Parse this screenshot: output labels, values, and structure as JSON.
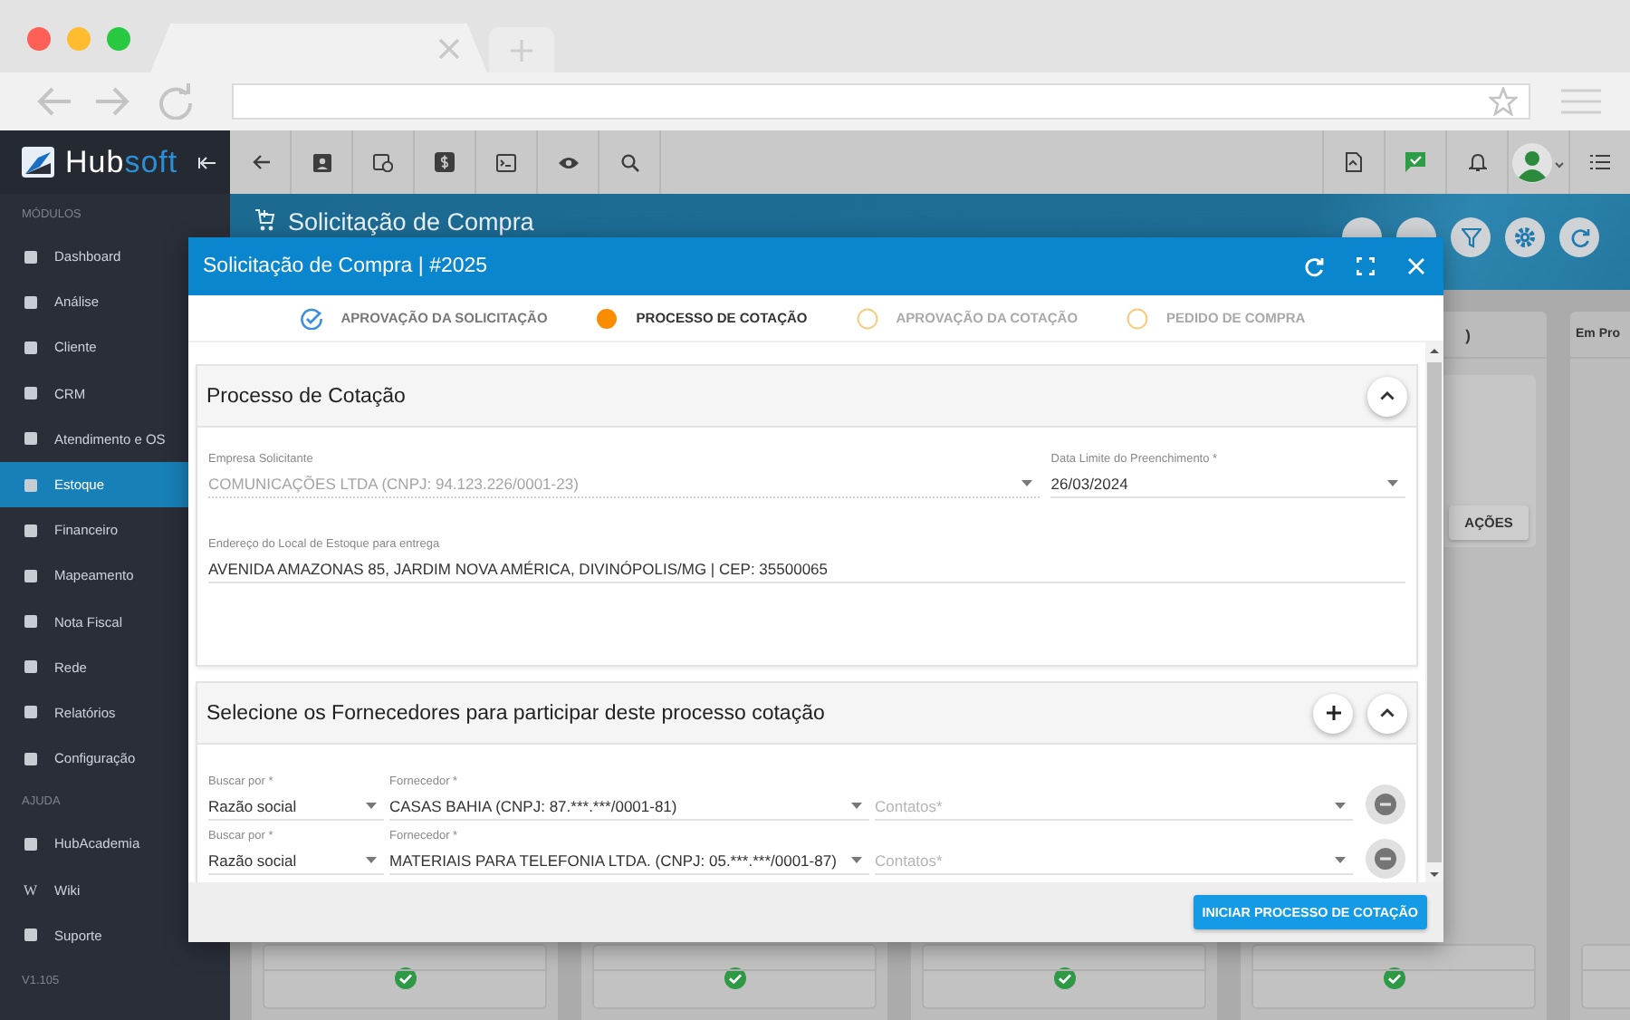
{
  "sidebar": {
    "logo": {
      "main": "Hub",
      "accent": "soft"
    },
    "sections": [
      {
        "title": "MÓDULOS",
        "items": [
          {
            "label": "Dashboard",
            "selected": false
          },
          {
            "label": "Análise",
            "selected": false
          },
          {
            "label": "Cliente",
            "selected": false
          },
          {
            "label": "CRM",
            "selected": false
          },
          {
            "label": "Atendimento e OS",
            "selected": false
          },
          {
            "label": "Estoque",
            "selected": true
          },
          {
            "label": "Financeiro",
            "selected": false
          },
          {
            "label": "Mapeamento",
            "selected": false
          },
          {
            "label": "Nota Fiscal",
            "selected": false
          },
          {
            "label": "Rede",
            "selected": false
          },
          {
            "label": "Relatórios",
            "selected": false
          },
          {
            "label": "Configuração",
            "selected": false
          }
        ]
      },
      {
        "title": "AJUDA",
        "items": [
          {
            "label": "HubAcademia",
            "selected": false
          },
          {
            "label": "Wiki",
            "selected": false,
            "icon_text": "W"
          },
          {
            "label": "Suporte",
            "selected": false
          }
        ]
      }
    ],
    "version": "V1.105"
  },
  "page": {
    "title": "Solicitação de Compra"
  },
  "board": {
    "columns": [
      {
        "title": ")",
        "action": "AÇÕES"
      },
      {
        "title": "Em Pro"
      }
    ]
  },
  "modal": {
    "title": "Solicitação de Compra | #2025",
    "steps": [
      {
        "label": "APROVAÇÃO DA SOLICITAÇÃO",
        "done": true,
        "current": false
      },
      {
        "label": "PROCESSO DE COTAÇÃO",
        "done": false,
        "current": true
      },
      {
        "label": "APROVAÇÃO DA COTAÇÃO",
        "done": false,
        "current": false
      },
      {
        "label": "PEDIDO DE COMPRA",
        "done": false,
        "current": false
      }
    ],
    "quote_section": {
      "title": "Processo de Cotação",
      "expanded": true,
      "company": {
        "label": "Empresa Solicitante",
        "value": "COMUNICAÇÕES LTDA (CNPJ: 94.123.226/0001-23)",
        "disabled": true
      },
      "deadline": {
        "label": "Data Limite do Preenchimento *",
        "value": "26/03/2024"
      },
      "address": {
        "label": "Endereço do Local de Estoque para entrega",
        "value": "AVENIDA AMAZONAS 85, JARDIM NOVA AMÉRICA, DIVINÓPOLIS/MG | CEP: 35500065"
      }
    },
    "suppliers_section": {
      "title": "Selecione os Fornecedores para participar deste processo cotação",
      "expanded": true,
      "rows": [
        {
          "search_label": "Buscar por *",
          "search_value": "Razão social",
          "supplier_label": "Fornecedor *",
          "supplier_value": "CASAS BAHIA (CNPJ: 87.***.***/0001-81)",
          "contacts_placeholder": "Contatos*"
        },
        {
          "search_label": "Buscar por *",
          "search_value": "Razão social",
          "supplier_label": "Fornecedor *",
          "supplier_value": "MATERIAIS PARA TELEFONIA LTDA. (CNPJ: 05.***.***/0001-87)",
          "contacts_placeholder": "Contatos*"
        }
      ]
    },
    "submit_button": "INICIAR PROCESSO DE COTAÇÃO"
  }
}
